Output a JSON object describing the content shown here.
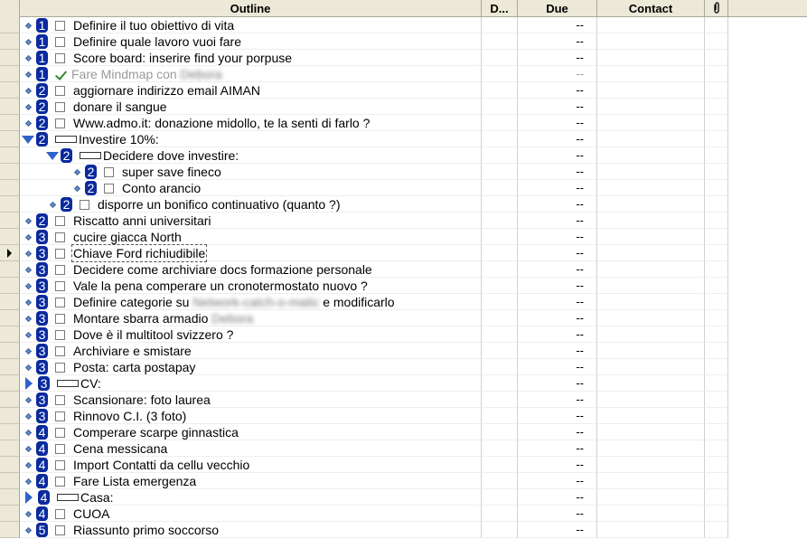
{
  "columns": {
    "outline": "Outline",
    "d": "D...",
    "due": "Due",
    "contact": "Contact",
    "attach_icon": "paperclip-icon"
  },
  "colors": {
    "priority_badge": "#0a2a9e",
    "expand_triangle": "#2f63c9",
    "done_check": "#2f8a2f"
  },
  "rows": [
    {
      "kind": "task",
      "indent": 0,
      "prio": "1",
      "text": "Definire il tuo obiettivo di vita",
      "due": "--"
    },
    {
      "kind": "task",
      "indent": 0,
      "prio": "1",
      "text": "Definire quale lavoro vuoi fare",
      "due": "--"
    },
    {
      "kind": "task",
      "indent": 0,
      "prio": "1",
      "text": "Score board: inserire find your porpuse",
      "due": "--"
    },
    {
      "kind": "task",
      "indent": 0,
      "prio": "1",
      "done": true,
      "text": "Fare Mindmap con ",
      "blur": "Debora",
      "due": "--"
    },
    {
      "kind": "task",
      "indent": 0,
      "prio": "2",
      "text": "aggiornare indirizzo email AIMAN",
      "due": "--"
    },
    {
      "kind": "task",
      "indent": 0,
      "prio": "2",
      "text": "donare il sangue",
      "due": "--"
    },
    {
      "kind": "task",
      "indent": 0,
      "prio": "2",
      "text": "Www.admo.it: donazione midollo, te la senti di farlo ?",
      "due": "--"
    },
    {
      "kind": "group",
      "state": "expanded",
      "indent": 0,
      "prio": "2",
      "text": "Investire 10%:",
      "due": "--"
    },
    {
      "kind": "group",
      "state": "expanded",
      "indent": 1,
      "prio": "2",
      "text": "Decidere dove investire:",
      "due": "--"
    },
    {
      "kind": "task",
      "indent": 2,
      "prio": "2",
      "text": "super save fineco",
      "due": "--"
    },
    {
      "kind": "task",
      "indent": 2,
      "prio": "2",
      "text": "Conto arancio",
      "due": "--"
    },
    {
      "kind": "task",
      "indent": 1,
      "prio": "2",
      "text": "disporre un bonifico continuativo (quanto ?)",
      "due": "--"
    },
    {
      "kind": "task",
      "indent": 0,
      "prio": "2",
      "text": "Riscatto anni universitari",
      "due": "--"
    },
    {
      "kind": "task",
      "indent": 0,
      "prio": "3",
      "text": "cucire giacca North",
      "due": "--"
    },
    {
      "kind": "task",
      "indent": 0,
      "prio": "3",
      "current": true,
      "text": "Chiave Ford richiudibile",
      "due": "--"
    },
    {
      "kind": "task",
      "indent": 0,
      "prio": "3",
      "text": "Decidere come archiviare docs formazione personale",
      "due": "--"
    },
    {
      "kind": "task",
      "indent": 0,
      "prio": "3",
      "text": "Vale la pena comperare un cronotermostato nuovo ?",
      "due": "--"
    },
    {
      "kind": "task",
      "indent": 0,
      "prio": "3",
      "text": "Definire categorie su ",
      "blur": "Network-catch-o-matic",
      "after": " e modificarlo",
      "due": "--"
    },
    {
      "kind": "task",
      "indent": 0,
      "prio": "3",
      "text": "Montare sbarra armadio ",
      "blur": "Debora",
      "due": "--"
    },
    {
      "kind": "task",
      "indent": 0,
      "prio": "3",
      "text": "Dove è il multitool svizzero ?",
      "due": "--"
    },
    {
      "kind": "task",
      "indent": 0,
      "prio": "3",
      "text": "Archiviare e smistare",
      "due": "--"
    },
    {
      "kind": "task",
      "indent": 0,
      "prio": "3",
      "text": "Posta: carta postapay",
      "due": "--"
    },
    {
      "kind": "group",
      "state": "collapsed",
      "indent": 0,
      "prio": "3",
      "text": "CV:",
      "due": "--"
    },
    {
      "kind": "task",
      "indent": 0,
      "prio": "3",
      "text": "Scansionare: foto laurea",
      "due": "--"
    },
    {
      "kind": "task",
      "indent": 0,
      "prio": "3",
      "text": "Rinnovo C.I. (3 foto)",
      "due": "--"
    },
    {
      "kind": "task",
      "indent": 0,
      "prio": "4",
      "text": "Comperare scarpe ginnastica",
      "due": "--"
    },
    {
      "kind": "task",
      "indent": 0,
      "prio": "4",
      "text": "Cena messicana",
      "due": "--"
    },
    {
      "kind": "task",
      "indent": 0,
      "prio": "4",
      "text": "Import Contatti da cellu vecchio",
      "due": "--"
    },
    {
      "kind": "task",
      "indent": 0,
      "prio": "4",
      "text": "Fare Lista emergenza",
      "due": "--"
    },
    {
      "kind": "group",
      "state": "collapsed",
      "indent": 0,
      "prio": "4",
      "text": "Casa:",
      "due": "--"
    },
    {
      "kind": "task",
      "indent": 0,
      "prio": "4",
      "text": "CUOA",
      "due": "--"
    },
    {
      "kind": "task",
      "indent": 0,
      "prio": "5",
      "text": "Riassunto primo soccorso",
      "due": "--"
    }
  ]
}
